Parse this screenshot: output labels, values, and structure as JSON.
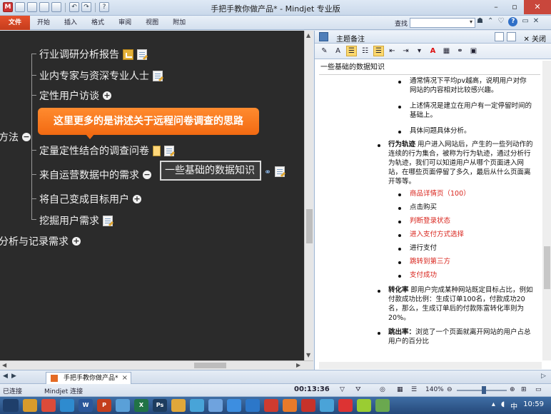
{
  "window": {
    "title": "手把手教你做产品* - Mindjet 专业版"
  },
  "ribbon": {
    "tabs": [
      "文件",
      "开始",
      "插入",
      "格式",
      "审阅",
      "视图",
      "附加"
    ],
    "find_label": "查找"
  },
  "map": {
    "parent_fragment": "方法",
    "nodes": [
      {
        "label": "行业调研分析报告",
        "icons": [
          "report-icon",
          "note-icon"
        ]
      },
      {
        "label": "业内专家与资深专业人士",
        "icons": [
          "note-icon"
        ]
      },
      {
        "label": "定性用户访谈",
        "icons": [
          "expand-icon"
        ]
      },
      {
        "label": "定量定性结合的调查问卷",
        "icons": [
          "attachment-icon",
          "note-icon"
        ]
      },
      {
        "label": "来自运营数据中的需求",
        "icons": [
          "expand-icon"
        ]
      },
      {
        "label": "将自己变成目标用户",
        "icons": [
          "expand-icon"
        ]
      },
      {
        "label": "挖掘用户需求",
        "icons": [
          "note-icon"
        ]
      }
    ],
    "sibling_fragment": "分析与记录需求",
    "callout_text": "这里更多的是讲述关于远程问卷调查的思路",
    "tooltip_text": "一些基础的数据知识",
    "collapse_glyph": "−",
    "expand_glyph": "+"
  },
  "notes_panel": {
    "title": "主题备注",
    "close_label": "关闭",
    "note_title": "一些基础的数据知识",
    "font_letter": "A",
    "blocks": [
      {
        "level": 2,
        "text": "通常情况下平均pv越高，说明用户对你网站的内容相对比较感兴趣。"
      },
      {
        "level": 2,
        "text": "上述情况是建立在用户有一定停留时间的基础上。"
      },
      {
        "level": 2,
        "text": "具体问题具体分析。"
      },
      {
        "level": 1,
        "bold": "行为轨迹",
        "text": "用户进入网站后，产生的一些列动作的连续的行为集合，被称为行为轨迹，通过分析行为轨迹，我们可以知道用户从哪个页面进入网站，在哪些页面停留了多久，最后从什么页面离开等等。"
      },
      {
        "level": 2,
        "text": "商品详情页（100）",
        "red": true
      },
      {
        "level": 2,
        "text": "点击购买"
      },
      {
        "level": 2,
        "text": "判断登录状态",
        "red": true
      },
      {
        "level": 2,
        "text": "进入支付方式选择",
        "red": true
      },
      {
        "level": 2,
        "text": "进行支付"
      },
      {
        "level": 2,
        "text": "跳转到第三方",
        "red": true
      },
      {
        "level": 2,
        "text": "支付成功",
        "red": true
      },
      {
        "level": 1,
        "bold": "转化率",
        "text": "即用户完成某种网站既定目标占比，例如付款成功比例：生成订单100名，付款成功20名，那么，生成订单后的付款陈富转化率则为20%。"
      },
      {
        "level": 1,
        "bold": "跳出率：",
        "text": "浏览了一个页面就离开网站的用户占总用户的百分比"
      }
    ]
  },
  "doc_tab": {
    "label": "手把手教你做产品*",
    "close_glyph": "×"
  },
  "status": {
    "connection": "已连接",
    "mindjet_connect": "Mindjet 连接",
    "timer": "00:13:36",
    "zoom": "140%"
  },
  "taskbar": {
    "apps": [
      "W",
      "P",
      "X",
      "Ps"
    ],
    "ime": "中",
    "clock": "10:59"
  },
  "colors": {
    "canvas_bg": "#2b2b2b",
    "callout": "#f26a12",
    "file_tab": "#d4451f",
    "note_red": "#d8231b"
  }
}
